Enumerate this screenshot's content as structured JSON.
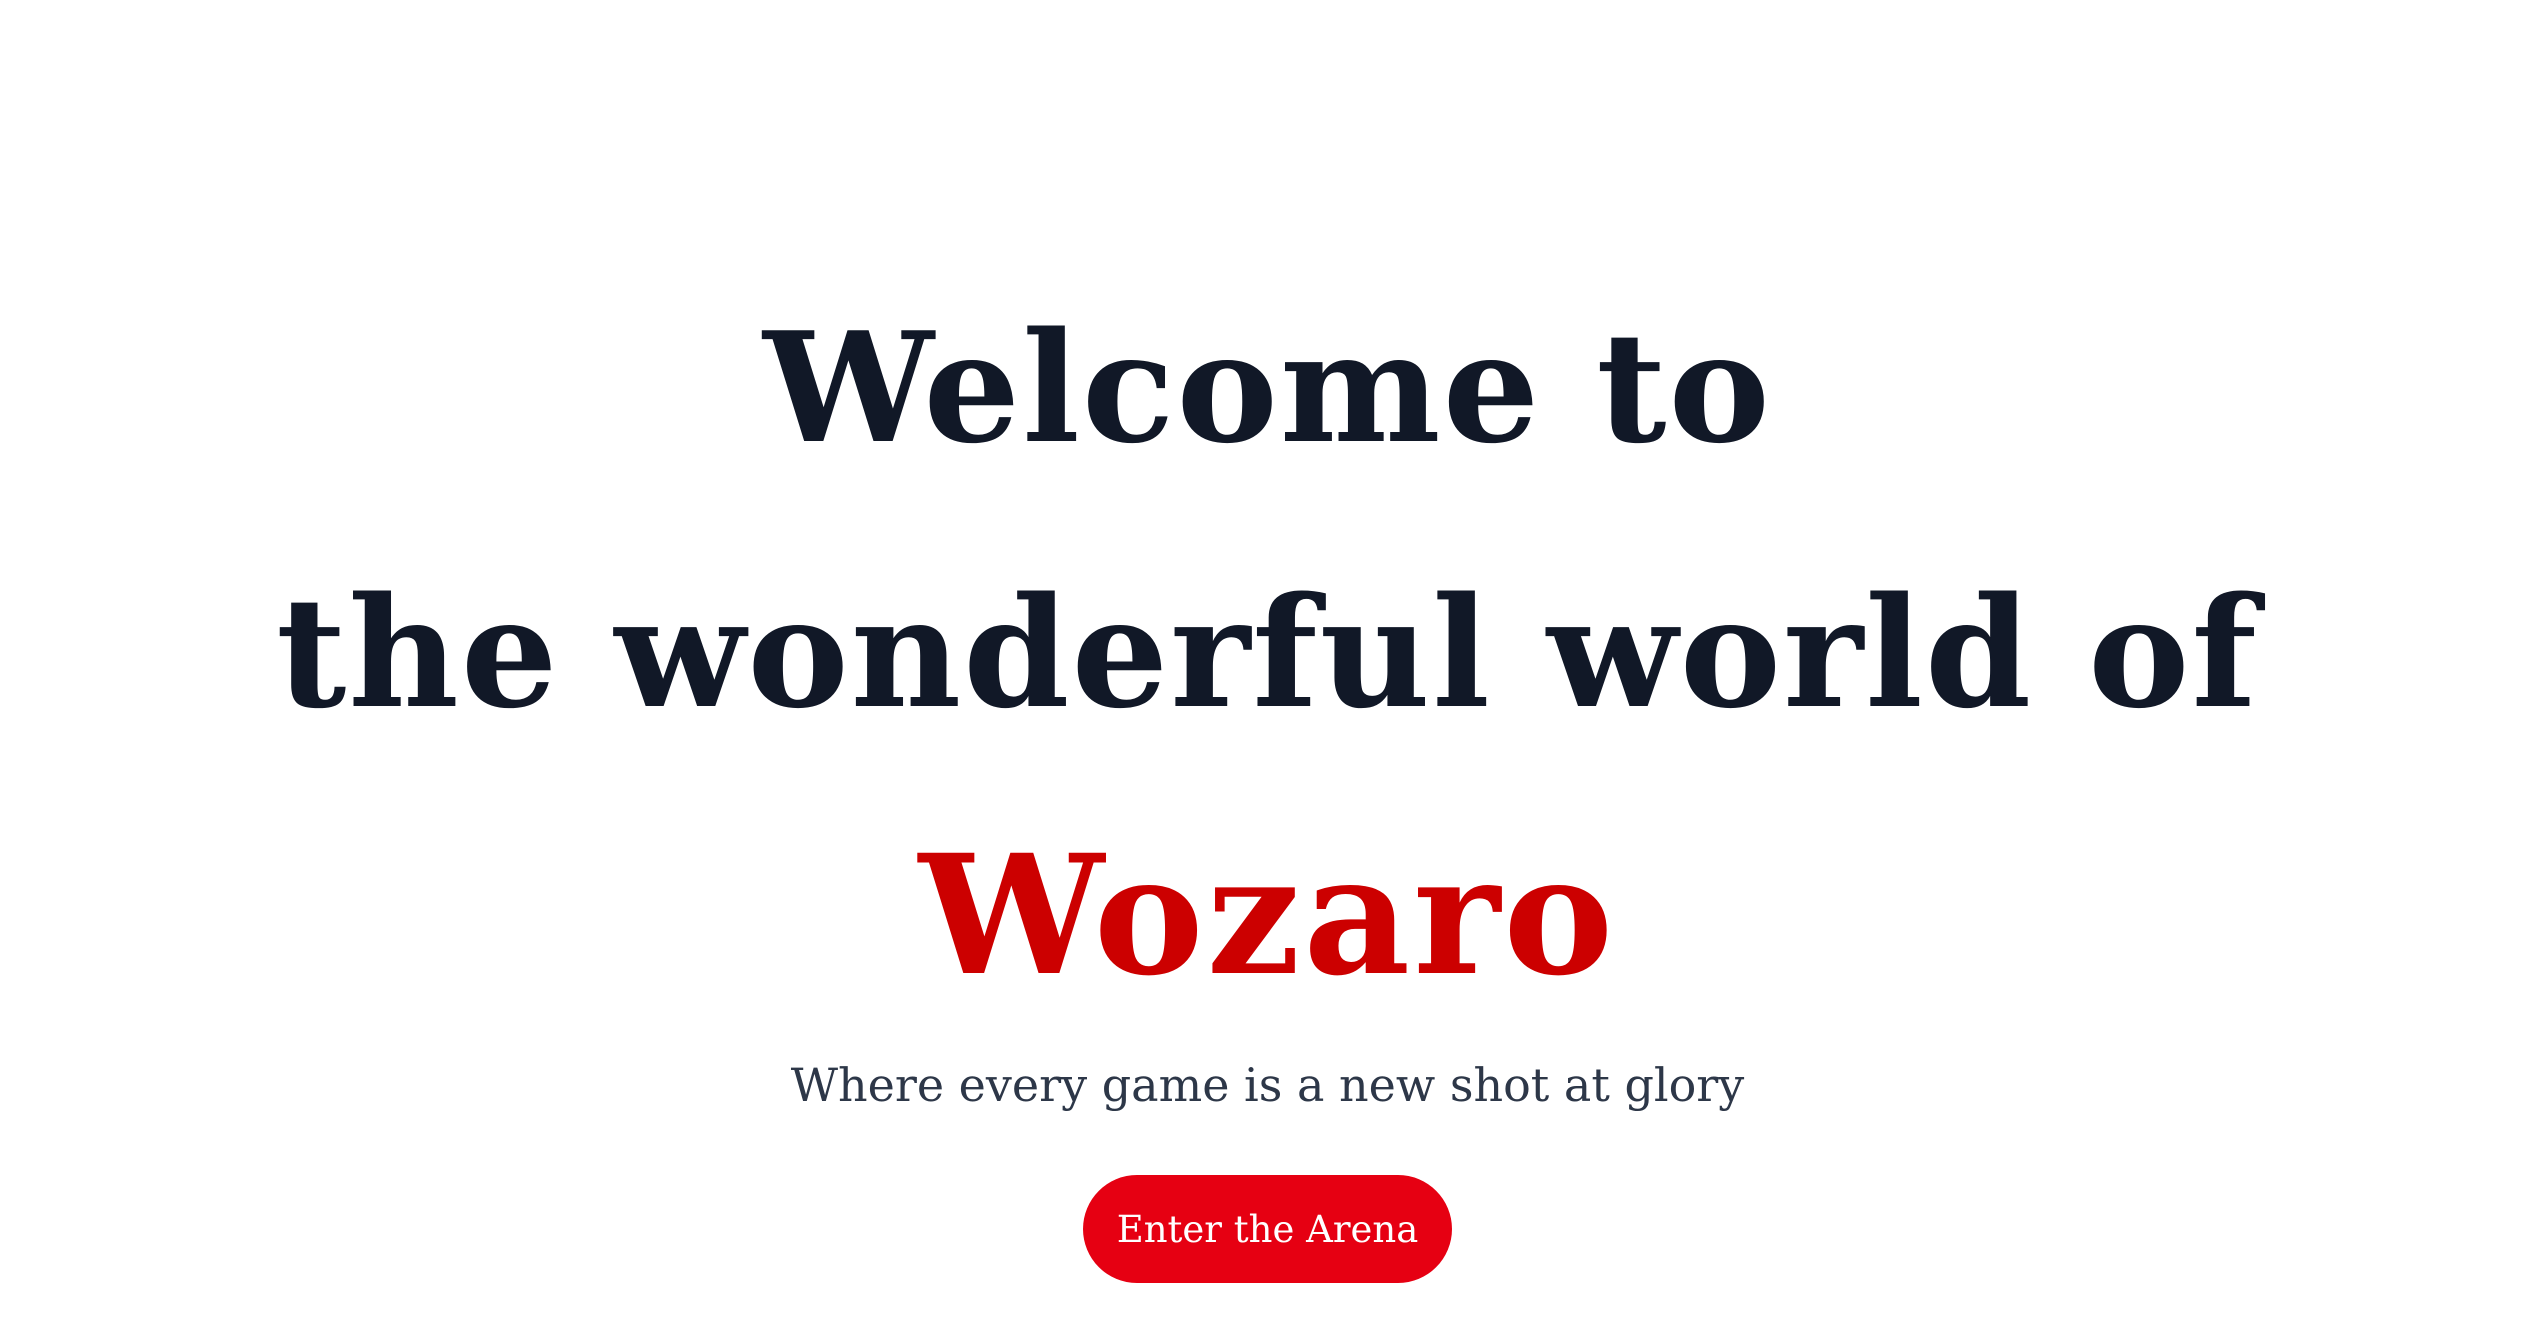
{
  "hero": {
    "headline_line1": "Welcome to",
    "headline_line2": "the wonderful world of",
    "brand": "Wozaro",
    "tagline": "Where every game is a new shot at glory",
    "cta_label": "Enter the Arena"
  },
  "colors": {
    "background": "#ffffff",
    "headline": "#111827",
    "brand": "#cc0000",
    "tagline": "#2d3748",
    "cta_background": "#e60012",
    "cta_text": "#ffffff"
  }
}
